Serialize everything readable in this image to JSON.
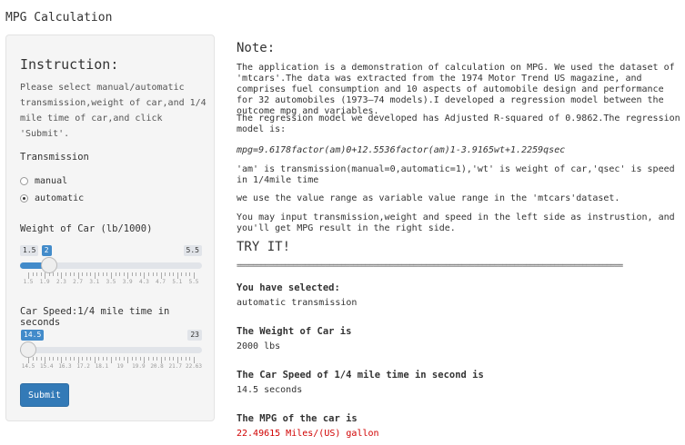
{
  "app_title": "MPG Calculation",
  "sidebar": {
    "instruction_title": "Instruction:",
    "instruction_text": "Please select manual/automatic transmission,weight of car,and 1/4 mile time of car,and click 'Submit'.",
    "transmission_label": "Transmission",
    "transmission_options": [
      {
        "label": "manual",
        "selected": false
      },
      {
        "label": "automatic",
        "selected": true
      }
    ],
    "weight": {
      "label": "Weight of Car (lb/1000)",
      "min": "1.5",
      "max": "5.5",
      "value": "2",
      "min_num": 1.5,
      "max_num": 5.5,
      "value_num": 2,
      "tick_labels": [
        "1.5",
        "1.9",
        "2.3",
        "2.7",
        "3.1",
        "3.5",
        "3.9",
        "4.3",
        "4.7",
        "5.1",
        "5.5"
      ]
    },
    "speed": {
      "label": "Car Speed:1/4 mile time in seconds",
      "min": "14.5",
      "max": "23",
      "value": "14.5",
      "min_num": 14.5,
      "max_num": 23,
      "value_num": 14.5,
      "tick_labels": [
        "14.5",
        "15.4",
        "16.3",
        "17.2",
        "18.1",
        "19",
        "19.9",
        "20.8",
        "21.7",
        "22.63"
      ]
    },
    "submit_label": "Submit"
  },
  "main": {
    "note_heading": "Note:",
    "p1": "The application is a demonstration of calculation on MPG. We used the dataset of 'mtcars'.The data was extracted from the 1974 Motor Trend US magazine, and comprises fuel consumption and 10 aspects of automobile design and performance for 32 automobiles (1973–74 models).I developed a regression model between the outcome mpg and variables.",
    "p2": "The regression model we developed has Adjusted R-squared of 0.9862.The regression model is:",
    "formula": "mpg=9.6178factor(am)0+12.5536factor(am)1-3.9165wt+1.2259qsec",
    "p3": "'am' is transmission(manual=0,automatic=1),'wt' is weight of car,'qsec' is speed in 1/4mile time",
    "p4": "we use the value range as variable value range in the 'mtcars'dataset.",
    "p5": "You may input transmission,weight and speed in the left side as instrustion, and you'll get MPG result in the right side.",
    "try_it": "TRY IT!",
    "divider": "================================================================================================",
    "selected_heading": "You have selected:",
    "selected_value": "automatic transmission",
    "weight_heading": "The Weight of Car is",
    "weight_value": "2000 lbs",
    "speed_heading": "The Car Speed of 1/4 mile time in second is",
    "speed_value": "14.5 seconds",
    "mpg_heading": "The MPG of the car is",
    "mpg_value": "22.49615 Miles/(US) gallon",
    "mpg_color": "#d00000"
  }
}
